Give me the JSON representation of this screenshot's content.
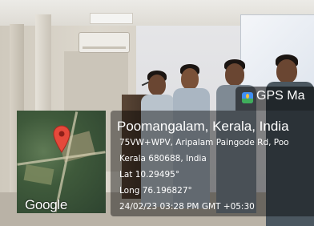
{
  "overlay": {
    "app_name": "GPS Ma",
    "place": "Poomangalam, Kerala, India",
    "address_line1": "75VW+WPV, Aripalam Paingode Rd, Poo",
    "address_line2": "Kerala 680688, India",
    "latitude": "Lat 10.29495°",
    "longitude": "Long 76.196827°",
    "datetime": "24/02/23 03:28 PM GMT +05:30"
  },
  "map": {
    "provider_label": "Google",
    "pin_color": "#e5493b"
  },
  "scene": {
    "people_count_visible": 5,
    "shirt_colors": [
      "#b9c3cc",
      "#aab6c2",
      "#7f8a94",
      "#4b5760",
      "#5f6a73"
    ]
  }
}
